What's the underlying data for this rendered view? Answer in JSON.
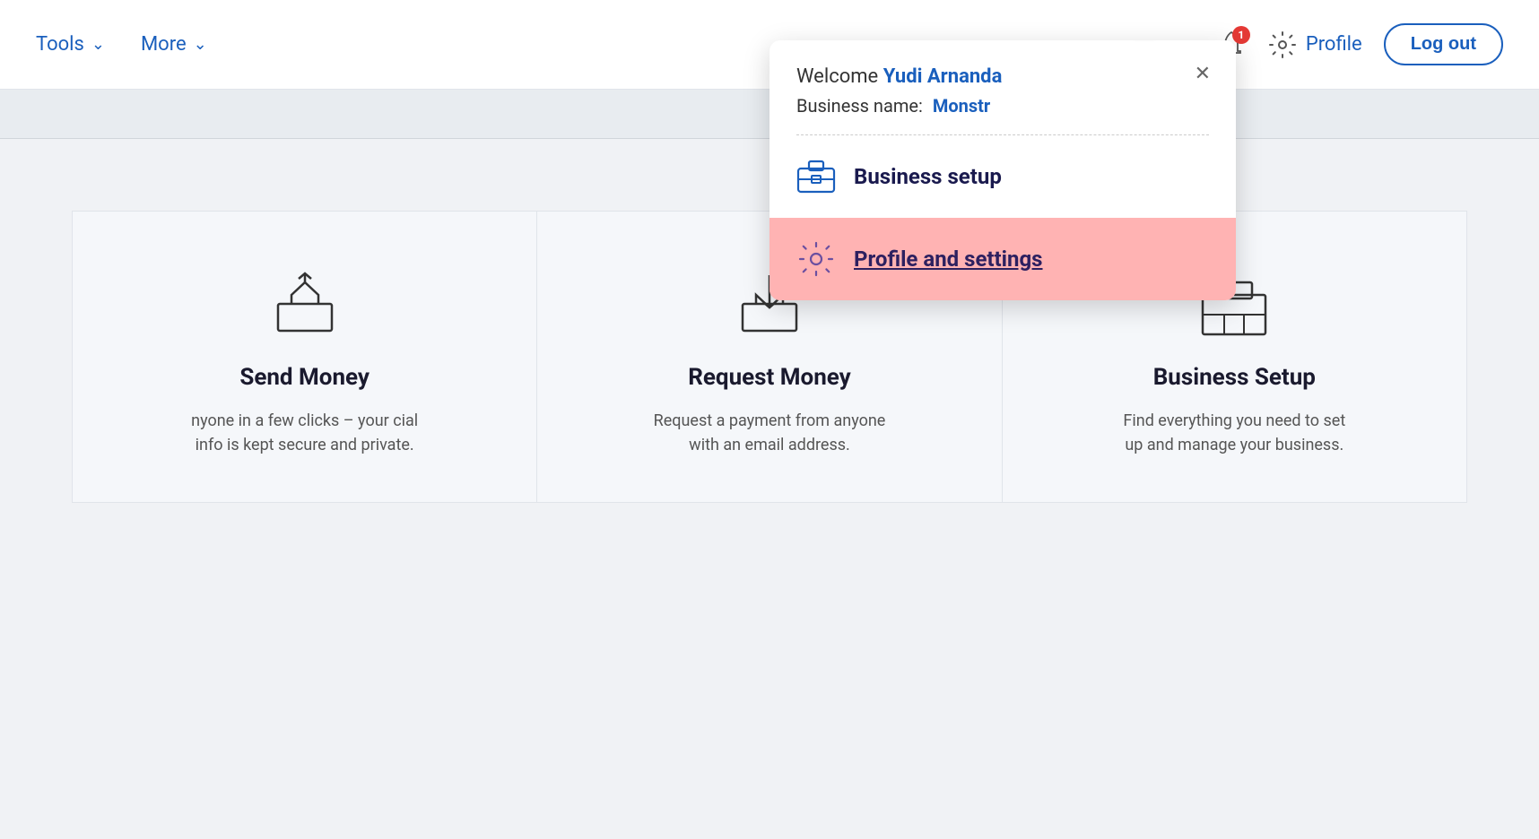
{
  "header": {
    "tools_label": "Tools",
    "more_label": "More",
    "notification_count": "1",
    "profile_label": "Profile",
    "logout_label": "Log out"
  },
  "popup": {
    "welcome_text": "Welcome",
    "user_name": "Yudi Arnanda",
    "business_label": "Business name:",
    "business_name": "Monstr",
    "menu_items": [
      {
        "id": "business-setup",
        "label": "Business setup",
        "active": false
      },
      {
        "id": "profile-settings",
        "label": "Profile and settings",
        "active": true
      }
    ]
  },
  "cards": [
    {
      "title": "Send Money",
      "description": "nyone in a few clicks – your cial info is kept secure and private."
    },
    {
      "title": "Request Money",
      "description": "Request a payment from anyone with an email address."
    },
    {
      "title": "Business Setup",
      "description": "Find everything you need to set up and manage your business."
    }
  ]
}
